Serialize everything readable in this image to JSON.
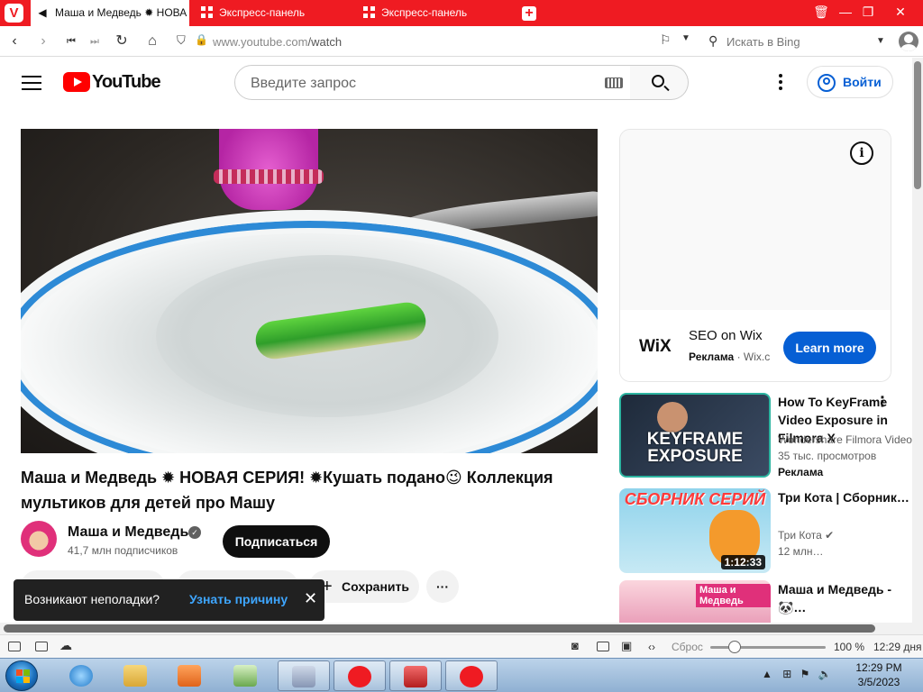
{
  "browser": {
    "tabs": [
      {
        "label": "Маша и Медведь ✹ НОВА",
        "active": true
      },
      {
        "label": "Экспресс-панель",
        "active": false
      },
      {
        "label": "Экспресс-панель",
        "active": false
      }
    ],
    "new_tab_label": "+",
    "url_host": "www.youtube.com",
    "url_path": "/watch",
    "search_placeholder": "Искать в Bing",
    "accent_color": "#ef1b22"
  },
  "youtube": {
    "logo_text": "YouTube",
    "search_placeholder": "Введите запрос",
    "signin_label": "Войти",
    "video": {
      "title": "Маша и Медведь ✹ НОВАЯ СЕРИЯ! ✹Кушать подано😉 Коллекция мультиков для детей про Машу",
      "channel": "Маша и Медведь",
      "subscribers": "41,7 млн подписчиков",
      "subscribe_label": "Подписаться",
      "save_label": "Сохранить",
      "more_label": "···"
    },
    "toast": {
      "message": "Возникают неполадки?",
      "link": "Узнать причину",
      "close": "✕"
    },
    "ad": {
      "logo": "WiX",
      "title": "SEO on Wix",
      "label": "Реклама",
      "domain": "Wix.c",
      "cta": "Learn more",
      "info": "i"
    },
    "recommendations": [
      {
        "title": "How To KeyFrame Video Exposure in Filmora X",
        "channel": "Wondershare Filmora Video",
        "meta": "35 тыс. просмотров",
        "ad_label": "Реклама",
        "thumb_text": "KEYFRAME EXPOSURE"
      },
      {
        "title": "Три Кота | Сборник…",
        "channel": "Три Кота",
        "meta": "12 млн…",
        "duration": "1:12:33",
        "thumb_text": "СБОРНИК СЕРИЙ"
      },
      {
        "title": "Маша и Медведь - 🐼…",
        "thumb_text": "Маша и Медведь"
      }
    ]
  },
  "statusbar": {
    "reset_label": "Сброс",
    "zoom": "100 %",
    "time": "12:29 дня",
    "zoom_level": 1.0
  },
  "taskbar": {
    "clock_time": "12:29 PM",
    "clock_date": "3/5/2023"
  }
}
